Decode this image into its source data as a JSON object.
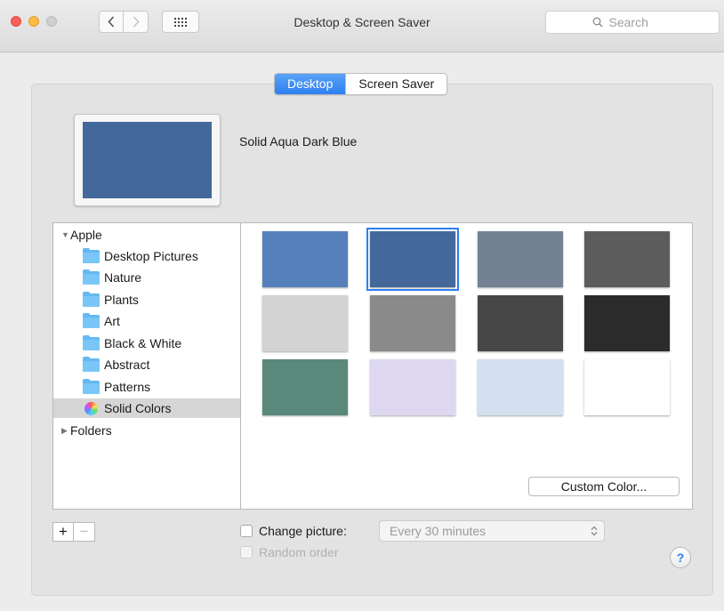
{
  "window": {
    "title": "Desktop & Screen Saver"
  },
  "toolbar": {
    "back_icon": "chevron-left-icon",
    "forward_icon": "chevron-right-icon",
    "grid_icon": "show-all-grid-icon"
  },
  "search": {
    "placeholder": "Search",
    "icon": "magnifier-icon"
  },
  "tabs": [
    {
      "label": "Desktop",
      "active": true
    },
    {
      "label": "Screen Saver",
      "active": false
    }
  ],
  "preview": {
    "title": "Solid Aqua Dark Blue",
    "color": "#45689b"
  },
  "sidebar": {
    "items": [
      {
        "label": "Apple",
        "type": "group",
        "expanded": true,
        "disclosure": "▼"
      },
      {
        "label": "Desktop Pictures",
        "type": "folder"
      },
      {
        "label": "Nature",
        "type": "folder"
      },
      {
        "label": "Plants",
        "type": "folder"
      },
      {
        "label": "Art",
        "type": "folder"
      },
      {
        "label": "Black & White",
        "type": "folder"
      },
      {
        "label": "Abstract",
        "type": "folder"
      },
      {
        "label": "Patterns",
        "type": "folder"
      },
      {
        "label": "Solid Colors",
        "type": "color-wheel",
        "selected": true
      },
      {
        "label": "Folders",
        "type": "group",
        "expanded": false,
        "disclosure": "▶"
      }
    ]
  },
  "swatches": [
    {
      "color": "#5580bc"
    },
    {
      "color": "#45689b",
      "selected": true
    },
    {
      "color": "#738193"
    },
    {
      "color": "#5c5c5c"
    },
    {
      "color": "#d3d3d3"
    },
    {
      "color": "#8a8a8a"
    },
    {
      "color": "#474747"
    },
    {
      "color": "#2b2b2b"
    },
    {
      "color": "#5a887a"
    },
    {
      "color": "#ddd8f0"
    },
    {
      "color": "#d4e0ef"
    },
    {
      "color": "#ffffff"
    }
  ],
  "custom_color_label": "Custom Color...",
  "add_remove": {
    "add": "+",
    "remove": "−"
  },
  "change_picture": {
    "label": "Change picture:",
    "checked": false,
    "interval": "Every 30 minutes"
  },
  "random_order": {
    "label": "Random order",
    "enabled": false
  },
  "help": {
    "label": "?"
  },
  "colors": {
    "accent": "#2e7ff0",
    "folder": "#64b9f2"
  }
}
